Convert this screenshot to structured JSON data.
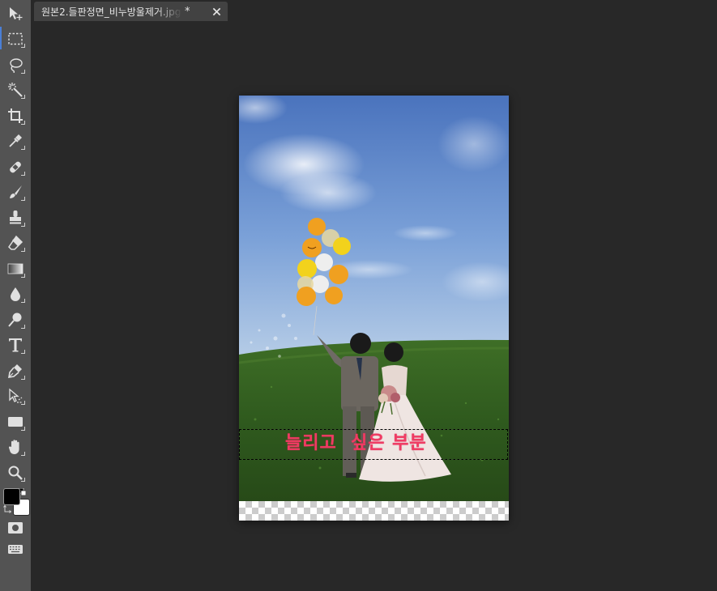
{
  "document_tab": {
    "title": "원본2.들판정면_비누방울제거.jpg",
    "modified_marker": "*"
  },
  "canvas": {
    "overlay_text": "늘리고  싶은 부분"
  },
  "toolbar": {
    "tools": [
      "move-tool",
      "rectangular-marquee-tool",
      "lasso-tool",
      "magic-wand-tool",
      "crop-tool",
      "eyedropper-tool",
      "healing-brush-tool",
      "brush-tool",
      "clone-stamp-tool",
      "eraser-tool",
      "gradient-tool",
      "blur-tool",
      "dodge-tool",
      "type-tool",
      "pen-tool",
      "path-selection-tool",
      "rectangle-tool",
      "hand-tool",
      "zoom-tool"
    ],
    "active_tool": "rectangular-marquee-tool",
    "foreground_color": "#000000",
    "background_color": "#ffffff"
  },
  "colors": {
    "workspace": "#282828",
    "toolbar": "#535353",
    "tab": "#424242",
    "selection_accent": "#4a7fd6",
    "overlay_text": "#f03b63"
  }
}
